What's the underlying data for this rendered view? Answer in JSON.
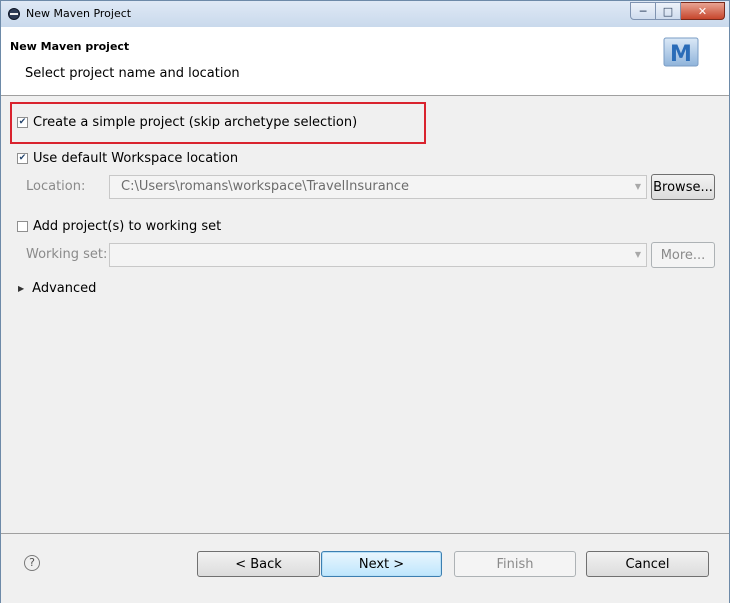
{
  "window": {
    "title": "New Maven Project"
  },
  "header": {
    "title": "New Maven project",
    "description": "Select project name and location",
    "logo_letter": "M"
  },
  "options": {
    "simple_project": {
      "label": "Create a simple project (skip archetype selection)",
      "checked": true
    },
    "default_workspace": {
      "label": "Use default Workspace location",
      "checked": true
    },
    "location": {
      "label": "Location:",
      "value": "C:\\Users\\romans\\workspace\\TravelInsurance",
      "browse_label": "Browse..."
    },
    "working_set_toggle": {
      "label": "Add project(s) to working set",
      "checked": false
    },
    "working_set": {
      "label": "Working set:",
      "value": "",
      "more_label": "More..."
    },
    "advanced": {
      "label": "Advanced"
    }
  },
  "footer": {
    "back": "< Back",
    "next": "Next >",
    "finish": "Finish",
    "cancel": "Cancel"
  },
  "colors": {
    "highlight": "#d9232e",
    "maven_blue": "#2a6cb8"
  }
}
